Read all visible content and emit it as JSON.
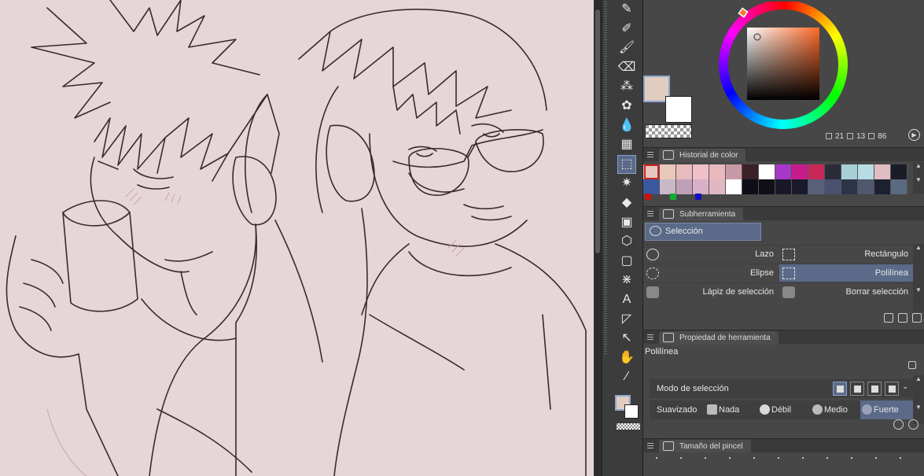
{
  "toolbar": {
    "tools": [
      {
        "name": "pen-tool-icon",
        "glyph": "✎"
      },
      {
        "name": "pencil-tool-icon",
        "glyph": "✐"
      },
      {
        "name": "brush-tool-icon",
        "glyph": "🖌"
      },
      {
        "name": "eraser-tool-icon",
        "glyph": "⌫"
      },
      {
        "name": "airbrush-tool-icon",
        "glyph": "⁂"
      },
      {
        "name": "decoration-tool-icon",
        "glyph": "✿"
      },
      {
        "name": "blend-tool-icon",
        "glyph": "💧"
      },
      {
        "name": "grid-tool-icon",
        "glyph": "▦"
      },
      {
        "name": "selection-tool-icon",
        "glyph": "⬚"
      },
      {
        "name": "auto-select-tool-icon",
        "glyph": "✷"
      },
      {
        "name": "fill-tool-icon",
        "glyph": "◆"
      },
      {
        "name": "gradient-tool-icon",
        "glyph": "▣"
      },
      {
        "name": "3d-object-tool-icon",
        "glyph": "⬡"
      },
      {
        "name": "figure-tool-icon",
        "glyph": "▢"
      },
      {
        "name": "frame-tool-icon",
        "glyph": "⋇"
      },
      {
        "name": "text-tool-icon",
        "glyph": "A"
      },
      {
        "name": "ruler-tool-icon",
        "glyph": "◸"
      },
      {
        "name": "object-tool-icon",
        "glyph": "↖"
      },
      {
        "name": "hand-tool-icon",
        "glyph": "✋"
      },
      {
        "name": "eyedropper-tool-icon",
        "glyph": "⁄"
      }
    ]
  },
  "colors": {
    "main": "#e0cdc0",
    "sub": "#ffffff",
    "accent": "#5a6a88"
  },
  "hsv": {
    "h": "21",
    "s": "13",
    "v": "86"
  },
  "history": {
    "title": "Historial de color",
    "row1": [
      "#e6c6c0",
      "#e8c8b8",
      "#e8bcbc",
      "#f0c0c8",
      "#e8b8bc",
      "#c89aa8",
      "#3a2228",
      "#ffffff",
      "#a838c8",
      "#c81c8c",
      "#c82858",
      "#2a2c3a",
      "#a8d0d8",
      "#b8dce4",
      "#e0bcc4",
      "#1a1c28"
    ],
    "row2": [
      "#3a58a0",
      "#c8b8c8",
      "#c0a0b8",
      "#d8b0c8",
      "#e0b8c4",
      "#ffffff",
      "#0e0e18",
      "#101018",
      "#181828",
      "#1a1a2c",
      "#58607a",
      "#4a5070",
      "#2e3448",
      "#50586e",
      "#1c2030",
      "#5a6a80"
    ],
    "dots": [
      "#cc1010",
      "#10b030",
      "#1010c0"
    ]
  },
  "subtool": {
    "title": "Subherramienta",
    "selected": "Selección",
    "items": [
      {
        "label": "Lazo"
      },
      {
        "label": "Rectángulo"
      },
      {
        "label": "Elipse"
      },
      {
        "label": "Polilínea"
      },
      {
        "label": "Lápiz de selección"
      },
      {
        "label": "Borrar selección"
      }
    ]
  },
  "toolprop": {
    "title": "Propiedad de herramienta",
    "name": "Polilínea",
    "mode_label": "Modo de selección",
    "smooth_label": "Suavizado",
    "smooth_options": [
      "Nada",
      "Débil",
      "Medio",
      "Fuerte"
    ]
  },
  "brushsize": {
    "title": "Tamaño del pincel"
  }
}
